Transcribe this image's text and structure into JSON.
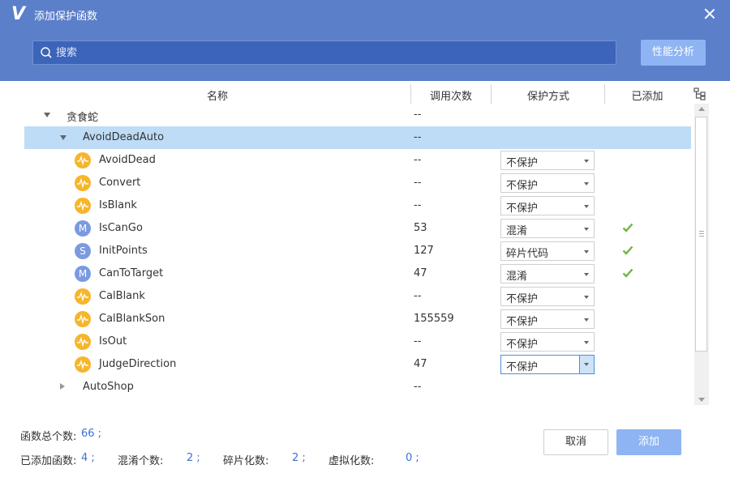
{
  "window": {
    "logo": "V",
    "title": "添加保护函数"
  },
  "search": {
    "placeholder": "搜索",
    "value": ""
  },
  "toolbar": {
    "perf_label": "性能分析"
  },
  "columns": {
    "name": "名称",
    "calls": "调用次数",
    "protect": "保护方式",
    "added": "已添加"
  },
  "rows": [
    {
      "name": "贪食蛇",
      "calls": "--",
      "icon": "none",
      "expander": "expanded"
    },
    {
      "name": "AvoidDeadAuto",
      "calls": "--",
      "icon": "none",
      "expander": "expanded",
      "selected": true
    },
    {
      "name": "AvoidDead",
      "calls": "--",
      "icon": "wave-icon",
      "protect": "不保护",
      "added": false
    },
    {
      "name": "Convert",
      "calls": "--",
      "icon": "wave-icon",
      "protect": "不保护",
      "added": false
    },
    {
      "name": "IsBlank",
      "calls": "--",
      "icon": "wave-icon",
      "protect": "不保护",
      "added": false
    },
    {
      "name": "IsCanGo",
      "calls": "53",
      "icon": "m-icon",
      "icon_letter": "M",
      "protect": "混淆",
      "added": true
    },
    {
      "name": "InitPoints",
      "calls": "127",
      "icon": "s-icon",
      "icon_letter": "S",
      "protect": "碎片代码",
      "added": true
    },
    {
      "name": "CanToTarget",
      "calls": "47",
      "icon": "m-icon",
      "icon_letter": "M",
      "protect": "混淆",
      "added": true
    },
    {
      "name": "CalBlank",
      "calls": "--",
      "icon": "wave-icon",
      "protect": "不保护",
      "added": false
    },
    {
      "name": "CalBlankSon",
      "calls": "155559",
      "icon": "wave-icon",
      "protect": "不保护",
      "added": false
    },
    {
      "name": "IsOut",
      "calls": "--",
      "icon": "wave-icon",
      "protect": "不保护",
      "added": false
    },
    {
      "name": "JudgeDirection",
      "calls": "47",
      "icon": "wave-icon",
      "protect": "不保护",
      "added": false,
      "focused": true
    },
    {
      "name": "AutoShop",
      "calls": "--",
      "icon": "none",
      "expander": "collapsed"
    }
  ],
  "stats": {
    "total_label": "函数总个数:",
    "total_value": "66 ;",
    "added_label": "已添加函数:",
    "added_value": "4 ;",
    "obf_label": "混淆个数:",
    "obf_value": "2 ;",
    "frag_label": "碎片化数:",
    "frag_value": "2 ;",
    "virt_label": "虚拟化数:",
    "virt_value": "0 ;"
  },
  "footer": {
    "cancel_label": "取消",
    "add_label": "添加"
  },
  "colors": {
    "header": "#5b7fc9",
    "search_bg": "#3c64b8",
    "accent_button": "#8eb4f3",
    "selected_row": "#bfdcf7",
    "check": "#6fb640",
    "wave_icon": "#f7b52b",
    "letter_icon": "#7b9ae0",
    "stat_value": "#3a6fd8"
  }
}
